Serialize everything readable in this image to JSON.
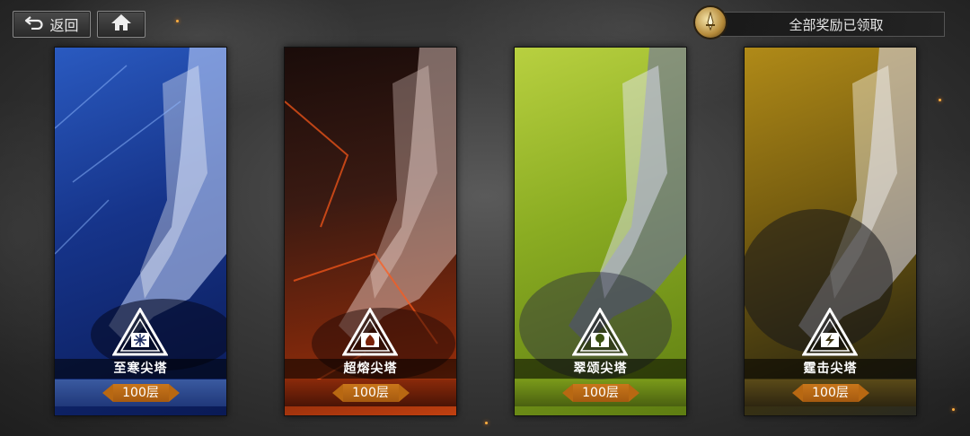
{
  "nav": {
    "back_label": "返回",
    "back_icon": "return-arrow-icon",
    "home_icon": "home-icon"
  },
  "reward": {
    "text": "全部奖励已领取",
    "icon": "sword-medal-icon"
  },
  "towers": [
    {
      "name": "至寒尖塔",
      "floors": "100层",
      "theme": "ice",
      "color_top": "#1d3f8f",
      "color_bottom": "#0a1a55",
      "glow": "#6fa8ff",
      "emblem": "snowflake-emblem-icon"
    },
    {
      "name": "超熔尖塔",
      "floors": "100层",
      "theme": "fire",
      "color_top": "#2a1410",
      "color_bottom": "#7a2208",
      "glow": "#ff5a1a",
      "emblem": "flame-emblem-icon"
    },
    {
      "name": "翠颂尖塔",
      "floors": "100层",
      "theme": "nature",
      "color_top": "#9bbf2a",
      "color_bottom": "#5e7d12",
      "glow": "#e0f060",
      "emblem": "tree-emblem-icon"
    },
    {
      "name": "霆击尖塔",
      "floors": "100层",
      "theme": "lightning",
      "color_top": "#8a6a10",
      "color_bottom": "#3a3210",
      "glow": "#ffd54a",
      "emblem": "lightning-emblem-icon"
    }
  ]
}
